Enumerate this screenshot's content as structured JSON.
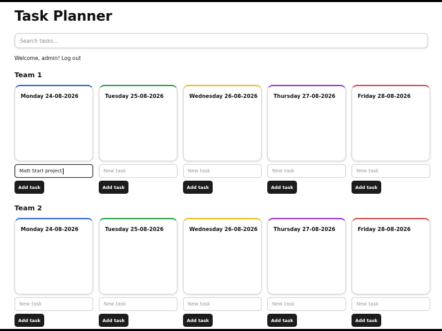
{
  "app": {
    "title": "Task Planner"
  },
  "search": {
    "placeholder": "Search tasks..."
  },
  "user": {
    "welcome": "Welcome, admin!",
    "logout": "Log out"
  },
  "colors": {
    "monday": "#3a6fd8",
    "tuesday": "#2fa84f",
    "wednesday": "#e8c12e",
    "thursday": "#9b3fd1",
    "friday": "#d9534f",
    "button": "#1c1c1c"
  },
  "teams": [
    {
      "name": "Team 1",
      "days": [
        {
          "date": "Monday 24-08-2026",
          "input_value": "Matt Start project",
          "placeholder": "New task",
          "button": "Add task"
        },
        {
          "date": "Tuesday 25-08-2026",
          "input_value": "",
          "placeholder": "New task",
          "button": "Add task"
        },
        {
          "date": "Wednesday 26-08-2026",
          "input_value": "",
          "placeholder": "New task",
          "button": "Add task"
        },
        {
          "date": "Thursday 27-08-2026",
          "input_value": "",
          "placeholder": "New task",
          "button": "Add task"
        },
        {
          "date": "Friday 28-08-2026",
          "input_value": "",
          "placeholder": "New task",
          "button": "Add task"
        }
      ]
    },
    {
      "name": "Team 2",
      "days": [
        {
          "date": "Monday 24-08-2026",
          "input_value": "",
          "placeholder": "New task",
          "button": "Add task"
        },
        {
          "date": "Tuesday 25-08-2026",
          "input_value": "",
          "placeholder": "New task",
          "button": "Add task"
        },
        {
          "date": "Wednesday 26-08-2026",
          "input_value": "",
          "placeholder": "New task",
          "button": "Add task"
        },
        {
          "date": "Thursday 27-08-2026",
          "input_value": "",
          "placeholder": "New task",
          "button": "Add task"
        },
        {
          "date": "Friday 28-08-2026",
          "input_value": "",
          "placeholder": "New task",
          "button": "Add task"
        }
      ]
    }
  ]
}
